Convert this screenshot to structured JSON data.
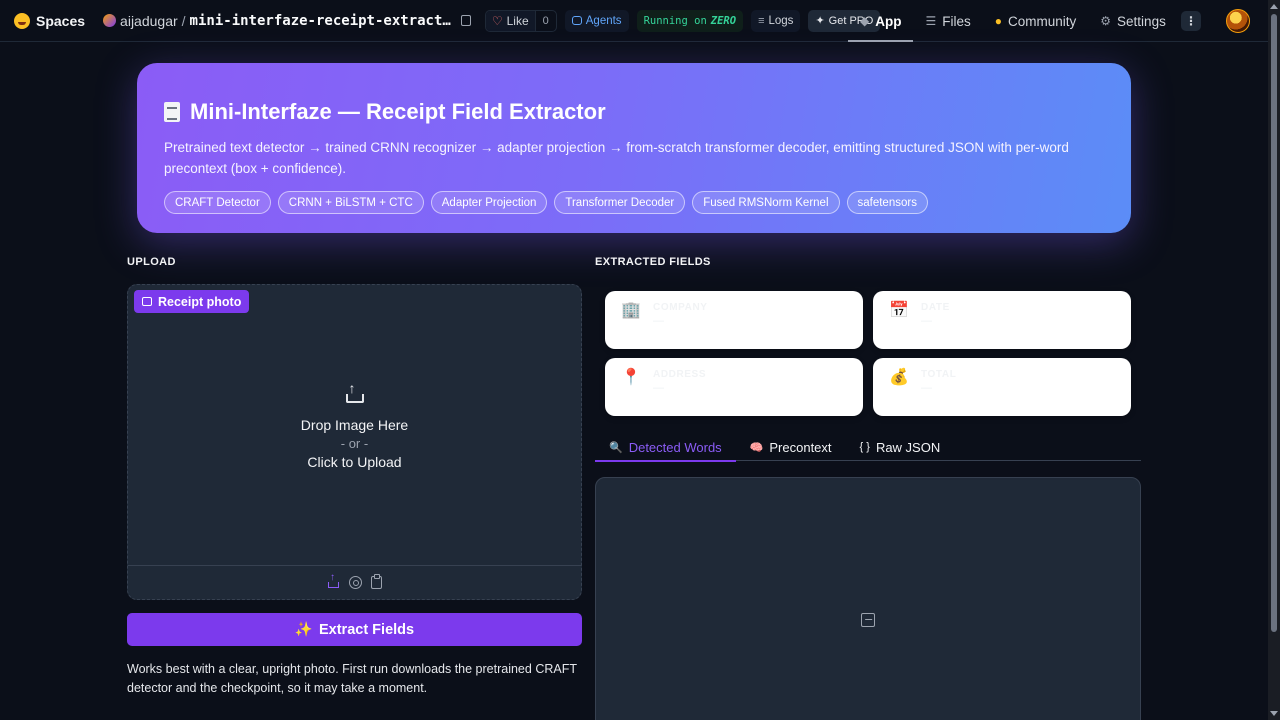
{
  "topbar": {
    "brand": "Spaces",
    "owner": "aijadugar",
    "separator": "/",
    "repo": "mini-interfaze-receipt-extract…",
    "like_label": "Like",
    "like_count": "0",
    "agents_label": "Agents",
    "running_prefix": "Running on",
    "running_hw": "ZERO",
    "logs_label": "Logs",
    "pro_label": "Get PRO",
    "nav_tabs": [
      {
        "label": "App",
        "icon": "cube-icon"
      },
      {
        "label": "Files",
        "icon": "files-icon"
      },
      {
        "label": "Community",
        "icon": "community-icon"
      },
      {
        "label": "Settings",
        "icon": "gear-icon"
      }
    ],
    "more_label": "⋮"
  },
  "hero": {
    "title": "Mini-Interfaze — Receipt Field Extractor",
    "description": "Pretrained text detector → trained CRNN recognizer → adapter projection → from-scratch transformer decoder, emitting structured JSON with per-word precontext (box + confidence).",
    "chips": [
      "CRAFT Detector",
      "CRNN + BiLSTM + CTC",
      "Adapter Projection",
      "Transformer Decoder",
      "Fused RMSNorm Kernel",
      "safetensors"
    ]
  },
  "upload": {
    "section_label": "UPLOAD",
    "badge": "Receipt photo",
    "drop_text": "Drop Image Here",
    "or_text": "- or -",
    "click_text": "Click to Upload",
    "extract_button": "Extract Fields",
    "extract_icon": "✨",
    "note": "Works best with a clear, upright photo. First run downloads the pretrained CRAFT detector and the checkpoint, so it may take a moment."
  },
  "fields": {
    "section_label": "EXTRACTED FIELDS",
    "items": [
      {
        "icon": "🏢",
        "label": "COMPANY",
        "value": "—"
      },
      {
        "icon": "📅",
        "label": "DATE",
        "value": "—"
      },
      {
        "icon": "📍",
        "label": "ADDRESS",
        "value": "—"
      },
      {
        "icon": "💰",
        "label": "TOTAL",
        "value": "—"
      }
    ]
  },
  "tabs": [
    {
      "icon": "🔍",
      "label": "Detected Words"
    },
    {
      "icon": "🧠",
      "label": "Precontext"
    },
    {
      "icon": "{ }",
      "label": "Raw JSON"
    }
  ],
  "colors": {
    "accent": "#7c3aed",
    "background": "#0b0f19",
    "panel": "#1f2937"
  }
}
